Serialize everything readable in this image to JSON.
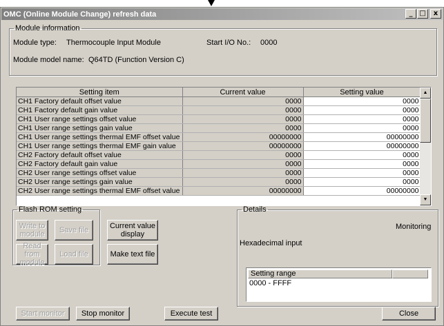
{
  "window": {
    "title": "OMC (Online Module Change) refresh data",
    "buttons": {
      "minimize": "_",
      "maximize": "□",
      "close": "x"
    }
  },
  "module_info": {
    "legend": "Module information",
    "type_label": "Module type:",
    "type_value": "Thermocouple Input Module",
    "start_io_label": "Start I/O No.:",
    "start_io_value": "0000",
    "model_label": "Module model name:",
    "model_value": "Q64TD (Function Version C)"
  },
  "table": {
    "headers": [
      "Setting item",
      "Current value",
      "Setting value"
    ],
    "rows": [
      {
        "item": "CH1 Factory default offset value",
        "current": "0000",
        "setting": "0000"
      },
      {
        "item": "CH1 Factory default gain value",
        "current": "0000",
        "setting": "0000"
      },
      {
        "item": "CH1 User range settings offset value",
        "current": "0000",
        "setting": "0000"
      },
      {
        "item": "CH1 User range settings gain value",
        "current": "0000",
        "setting": "0000"
      },
      {
        "item": "CH1 User range settings thermal EMF offset value",
        "current": "00000000",
        "setting": "00000000"
      },
      {
        "item": "CH1 User range settings thermal EMF gain value",
        "current": "00000000",
        "setting": "00000000"
      },
      {
        "item": "CH2 Factory default offset value",
        "current": "0000",
        "setting": "0000"
      },
      {
        "item": "CH2 Factory default gain value",
        "current": "0000",
        "setting": "0000"
      },
      {
        "item": "CH2 User range settings offset value",
        "current": "0000",
        "setting": "0000"
      },
      {
        "item": "CH2 User range settings gain value",
        "current": "0000",
        "setting": "0000"
      },
      {
        "item": "CH2 User range settings thermal EMF offset value",
        "current": "00000000",
        "setting": "00000000"
      }
    ]
  },
  "flash_rom": {
    "legend": "Flash ROM setting",
    "write_to_module": "Write to module",
    "save_file": "Save file",
    "read_from_module": "Read from module",
    "load_file": "Load file"
  },
  "actions": {
    "current_value_display": "Current value display",
    "make_text_file": "Make text file",
    "start_monitor": "Start monitor",
    "stop_monitor": "Stop monitor",
    "execute_test": "Execute test",
    "close": "Close"
  },
  "details": {
    "legend": "Details",
    "status": "Monitoring",
    "input_mode": "Hexadecimal input",
    "range_header": "Setting range",
    "range_value": "0000 - FFFF"
  }
}
